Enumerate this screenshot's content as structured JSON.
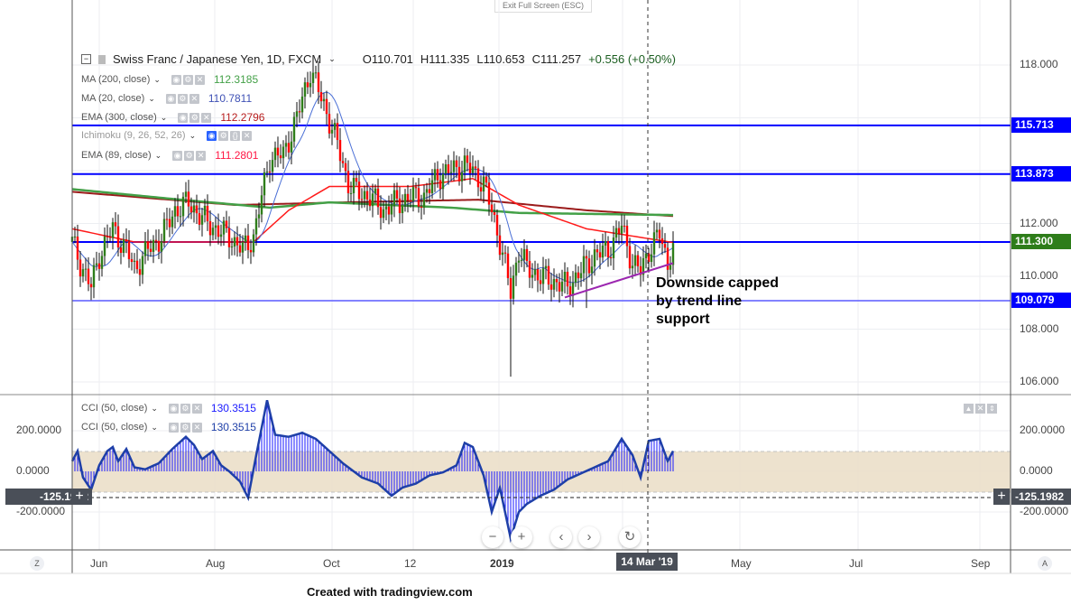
{
  "top_bar": {
    "exit_fullscreen": "Exit Full Screen (ESC)"
  },
  "symbol": {
    "title": "Swiss Franc / Japanese Yen, 1D, FXCM",
    "open": "O110.701",
    "high": "H111.335",
    "low": "L110.653",
    "close": "C111.257",
    "change": "+0.556 (+0.50%)"
  },
  "indicators": [
    {
      "label": "MA (200, close)",
      "value": "112.3185",
      "color": "#43a047"
    },
    {
      "label": "MA (20, close)",
      "value": "110.7811",
      "color": "#3f51b5"
    },
    {
      "label": "EMA (300, close)",
      "value": "112.2796",
      "color": "#b71c1c"
    },
    {
      "label": "Ichimoku (9, 26, 52, 26)",
      "value": "",
      "color": "#9e9e9e"
    },
    {
      "label": "EMA (89, close)",
      "value": "111.2801",
      "color": "#ff1744"
    }
  ],
  "cci": [
    {
      "label": "CCI (50, close)",
      "value": "130.3515",
      "color": "#1a1aff"
    },
    {
      "label": "CCI (50, close)",
      "value": "130.3515",
      "color": "#1e3fa8"
    }
  ],
  "price_axis": [
    "118.000",
    "112.000",
    "110.000",
    "108.000",
    "106.000"
  ],
  "cci_axis": [
    "200.0000",
    "0.0000",
    "-200.0000"
  ],
  "cci_crosshair_value": "-125.1982",
  "price_levels": [
    {
      "value": 115.713,
      "label": "115.713",
      "color": "#0000ff"
    },
    {
      "value": 113.873,
      "label": "113.873",
      "color": "#0000ff"
    },
    {
      "value": 111.3,
      "label": "111.300",
      "color": "#2e7d1a"
    },
    {
      "value": 109.079,
      "label": "109.079",
      "color": "#0000ff"
    }
  ],
  "time_axis": [
    "Jun",
    "Aug",
    "Oct",
    "12",
    "2019",
    "May",
    "Jul",
    "Sep"
  ],
  "time_axis_bold": "2019",
  "crosshair_date": "14 Mar '19",
  "annotation": [
    "Downside capped",
    "by trend line",
    "support"
  ],
  "footer": "Created with tradingview.com",
  "corner_left": "Z",
  "corner_right": "A",
  "chart_data": {
    "type": "candlestick",
    "unit": "trading-day index",
    "close_keypoints": [
      [
        0,
        111.3
      ],
      [
        3,
        110.5
      ],
      [
        7,
        109.6
      ],
      [
        10,
        110.8
      ],
      [
        15,
        111.8
      ],
      [
        20,
        111
      ],
      [
        23,
        110.3
      ],
      [
        28,
        111
      ],
      [
        33,
        111.5
      ],
      [
        38,
        112.5
      ],
      [
        43,
        112.8
      ],
      [
        48,
        112.2
      ],
      [
        53,
        111.8
      ],
      [
        58,
        111.5
      ],
      [
        63,
        111
      ],
      [
        67,
        111.5
      ],
      [
        70,
        113
      ],
      [
        73,
        114.5
      ],
      [
        78,
        114.6
      ],
      [
        83,
        116
      ],
      [
        88,
        117.8
      ],
      [
        93,
        116.5
      ],
      [
        98,
        115
      ],
      [
        102,
        113.5
      ],
      [
        105,
        113.2
      ],
      [
        110,
        113
      ],
      [
        115,
        112.5
      ],
      [
        120,
        112.8
      ],
      [
        125,
        113
      ],
      [
        130,
        113
      ],
      [
        135,
        113.8
      ],
      [
        140,
        114
      ],
      [
        145,
        114.2
      ],
      [
        148,
        114
      ],
      [
        152,
        113.5
      ],
      [
        155,
        112.5
      ],
      [
        158,
        111.3
      ],
      [
        162,
        109.4
      ],
      [
        165,
        111
      ],
      [
        168,
        110.3
      ],
      [
        173,
        110
      ],
      [
        178,
        109.8
      ],
      [
        183,
        109.6
      ],
      [
        188,
        110.2
      ],
      [
        193,
        110.8
      ],
      [
        198,
        111
      ],
      [
        203,
        111.9
      ],
      [
        207,
        110.5
      ],
      [
        210,
        110.2
      ],
      [
        213,
        111
      ],
      [
        217,
        111.6
      ],
      [
        220,
        110.5
      ],
      [
        222,
        111.26
      ]
    ],
    "ma200": [
      [
        0,
        113.3
      ],
      [
        40,
        112.9
      ],
      [
        73,
        112.6
      ],
      [
        95,
        112.8
      ],
      [
        140,
        112.6
      ],
      [
        165,
        112.4
      ],
      [
        222,
        112.32
      ]
    ],
    "ema300": [
      [
        0,
        113.2
      ],
      [
        60,
        112.7
      ],
      [
        100,
        112.8
      ],
      [
        150,
        112.9
      ],
      [
        190,
        112.5
      ],
      [
        222,
        112.28
      ]
    ],
    "ema89": [
      [
        0,
        111.8
      ],
      [
        23,
        111.3
      ],
      [
        67,
        111.3
      ],
      [
        80,
        112.5
      ],
      [
        95,
        113.4
      ],
      [
        125,
        113.4
      ],
      [
        148,
        113.7
      ],
      [
        165,
        112.7
      ],
      [
        190,
        111.8
      ],
      [
        222,
        111.28
      ]
    ],
    "cci": [
      [
        0,
        50
      ],
      [
        2,
        100
      ],
      [
        4,
        -30
      ],
      [
        7,
        -90
      ],
      [
        10,
        30
      ],
      [
        13,
        100
      ],
      [
        15,
        120
      ],
      [
        17,
        50
      ],
      [
        20,
        110
      ],
      [
        23,
        20
      ],
      [
        27,
        10
      ],
      [
        32,
        40
      ],
      [
        37,
        110
      ],
      [
        42,
        170
      ],
      [
        45,
        130
      ],
      [
        48,
        60
      ],
      [
        52,
        100
      ],
      [
        55,
        30
      ],
      [
        58,
        0
      ],
      [
        62,
        -50
      ],
      [
        65,
        -130
      ],
      [
        68,
        80
      ],
      [
        72,
        350
      ],
      [
        75,
        180
      ],
      [
        80,
        170
      ],
      [
        85,
        190
      ],
      [
        90,
        160
      ],
      [
        95,
        100
      ],
      [
        100,
        40
      ],
      [
        107,
        -30
      ],
      [
        113,
        -60
      ],
      [
        118,
        -120
      ],
      [
        122,
        -80
      ],
      [
        127,
        -60
      ],
      [
        132,
        -20
      ],
      [
        137,
        -5
      ],
      [
        142,
        30
      ],
      [
        145,
        140
      ],
      [
        148,
        120
      ],
      [
        152,
        -20
      ],
      [
        155,
        -200
      ],
      [
        158,
        -80
      ],
      [
        162,
        -330
      ],
      [
        165,
        -200
      ],
      [
        168,
        -160
      ],
      [
        173,
        -120
      ],
      [
        178,
        -90
      ],
      [
        183,
        -40
      ],
      [
        188,
        -10
      ],
      [
        193,
        20
      ],
      [
        198,
        50
      ],
      [
        203,
        160
      ],
      [
        207,
        80
      ],
      [
        210,
        -30
      ],
      [
        213,
        150
      ],
      [
        217,
        160
      ],
      [
        220,
        50
      ],
      [
        222,
        100
      ]
    ],
    "trend_line": [
      [
        182,
        109.2
      ],
      [
        222,
        110.5
      ]
    ],
    "ylim": [
      106,
      118.5
    ],
    "cci_band": [
      -100,
      100
    ]
  }
}
